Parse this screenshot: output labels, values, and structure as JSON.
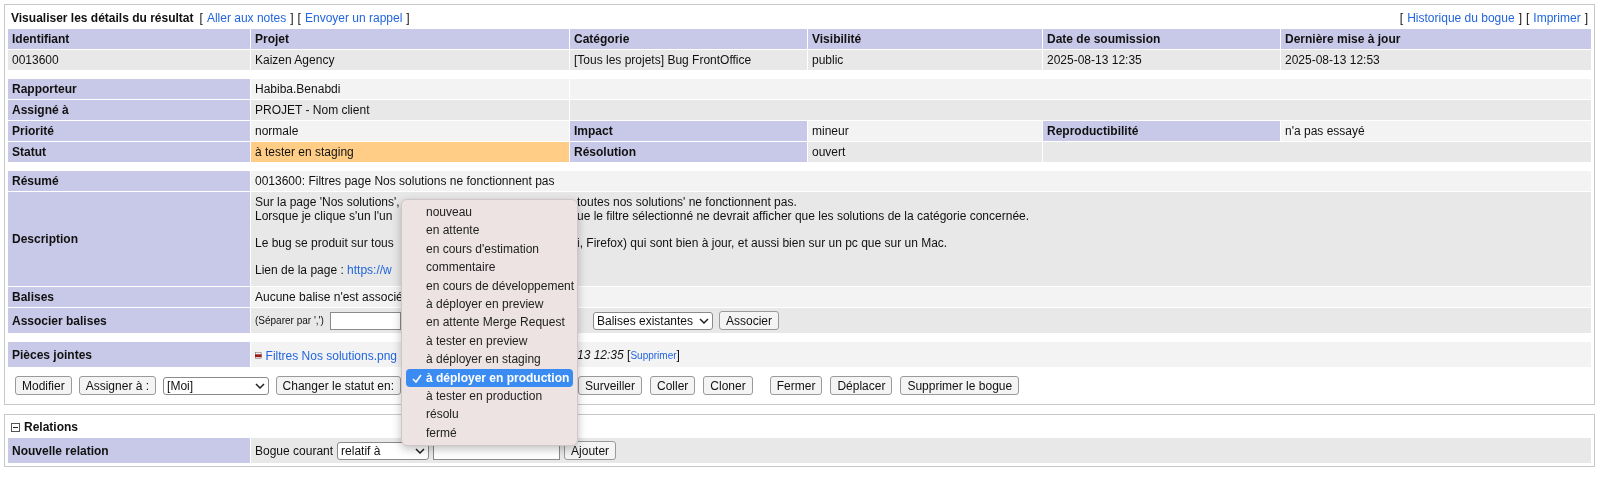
{
  "header": {
    "title": "Visualiser les détails du résultat",
    "left_links": [
      {
        "open": "[",
        "label": "Aller aux notes",
        "close": "]"
      },
      {
        "open": "[",
        "label": "Envoyer un rappel",
        "close": "]"
      }
    ],
    "right_links": [
      {
        "open": "[",
        "label": "Historique du bogue",
        "close": "]"
      },
      {
        "open": "[",
        "label": "Imprimer",
        "close": "]"
      }
    ]
  },
  "overview": {
    "columns": [
      "Identifiant",
      "Projet",
      "Catégorie",
      "Visibilité",
      "Date de soumission",
      "Dernière mise à jour"
    ],
    "row": [
      "0013600",
      "Kaizen Agency",
      "[Tous les projets] Bug FrontOffice",
      "public",
      "2025-08-13 12:35",
      "2025-08-13 12:53"
    ]
  },
  "fields": [
    {
      "cells": [
        {
          "kind": "label",
          "text": "Rapporteur"
        },
        {
          "kind": "value",
          "text": "Habiba.Benabdi",
          "highlighted": false
        }
      ]
    },
    {
      "cells": [
        {
          "kind": "label",
          "text": "Assigné à"
        },
        {
          "kind": "value",
          "text": "PROJET - Nom client",
          "highlighted": false
        }
      ]
    },
    {
      "cells": [
        {
          "kind": "label",
          "text": "Priorité"
        },
        {
          "kind": "value",
          "text": "normale",
          "highlighted": false
        },
        {
          "kind": "label",
          "text": "Impact"
        },
        {
          "kind": "value",
          "text": "mineur",
          "highlighted": false
        },
        {
          "kind": "label",
          "text": "Reproductibilité"
        },
        {
          "kind": "value",
          "text": "n'a pas essayé",
          "highlighted": false
        }
      ]
    },
    {
      "cells": [
        {
          "kind": "label",
          "text": "Statut"
        },
        {
          "kind": "value",
          "text": "à tester en staging",
          "highlighted": true
        },
        {
          "kind": "label",
          "text": "Résolution"
        },
        {
          "kind": "value",
          "text": "ouvert",
          "highlighted": false
        }
      ]
    }
  ],
  "summary": {
    "label": "Résumé",
    "text": "0013600: Filtres page Nos solutions ne fonctionnent pas"
  },
  "description": {
    "label": "Description",
    "paragraphs": [
      [
        {
          "left": "Sur la page 'Nos solutions',",
          "right": "toutes nos solutions' ne fonctionnent pas."
        },
        {
          "left": "Lorsque je clique s'un l'un",
          "right": "ue le filtre sélectionné ne devrait afficher que les solutions de la catégorie concernée."
        }
      ],
      [
        {
          "left": "Le bug se produit sur tous",
          "right": "i, Firefox) qui sont bien à jour, et aussi bien sur un pc que sur un Mac."
        }
      ],
      [
        {
          "left": "Lien de la page :",
          "link": "https://w"
        }
      ]
    ]
  },
  "tags": {
    "label": "Balises",
    "text": "Aucune balise n'est associé"
  },
  "add_tags": {
    "label": "Associer balises",
    "hint": "(Séparer par ',')",
    "select": "Balises existantes",
    "button": "Associer"
  },
  "attachments": {
    "label": "Pièces jointes",
    "file": "Filtres Nos solutions.png",
    "date": "13 12:35",
    "open": "[",
    "delete": "Supprimer",
    "close": "]"
  },
  "actions": {
    "left": [
      {
        "kind": "button",
        "label": "Modifier"
      },
      {
        "kind": "button",
        "label": "Assigner à :"
      },
      {
        "kind": "select",
        "value": "[Moi]"
      },
      {
        "kind": "button",
        "label": "Changer le statut en:"
      }
    ],
    "right": [
      [
        "Surveiller",
        "Coller",
        "Cloner"
      ],
      [
        "Fermer",
        "Déplacer",
        "Supprimer le bogue"
      ]
    ]
  },
  "status_menu": {
    "options": [
      {
        "label": "nouveau",
        "selected": false
      },
      {
        "label": "en attente",
        "selected": false
      },
      {
        "label": "en cours d'estimation",
        "selected": false
      },
      {
        "label": "commentaire",
        "selected": false
      },
      {
        "label": "en cours de développement",
        "selected": false
      },
      {
        "label": "à déployer en preview",
        "selected": false
      },
      {
        "label": "en attente Merge Request",
        "selected": false
      },
      {
        "label": "à tester en preview",
        "selected": false
      },
      {
        "label": "à déployer en staging",
        "selected": false
      },
      {
        "label": "à déployer en production",
        "selected": true
      },
      {
        "label": "à tester en production",
        "selected": false
      },
      {
        "label": "résolu",
        "selected": false
      },
      {
        "label": "fermé",
        "selected": false
      }
    ]
  },
  "relations": {
    "title": "Relations",
    "expanded": true,
    "label": "Nouvelle relation",
    "text": "Bogue courant",
    "select": "relatif à",
    "button": "Ajouter"
  }
}
